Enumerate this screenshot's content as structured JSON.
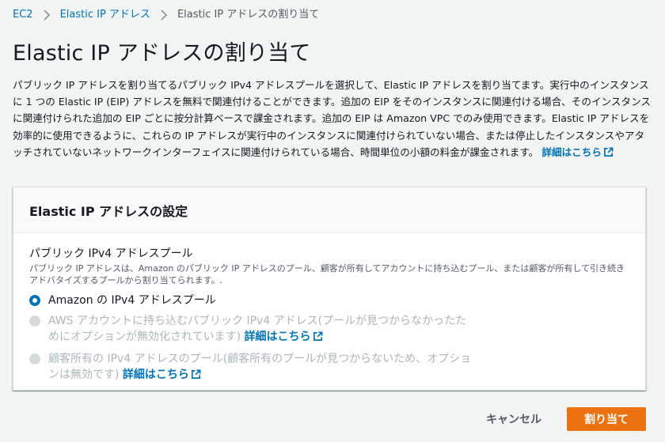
{
  "breadcrumb": {
    "items": [
      "EC2",
      "Elastic IP アドレス"
    ],
    "current": "Elastic IP アドレスの割り当て"
  },
  "page": {
    "title": "Elastic IP アドレスの割り当て",
    "description": "パブリック IP アドレスを割り当てるパブリック IPv4 アドレスプールを選択して、Elastic IP アドレスを割り当てます。実行中のインスタンスに 1 つの Elastic IP (EIP) アドレスを無料で関連付けることができます。追加の EIP をそのインスタンスに関連付ける場合、そのインスタンスに関連付けられた追加の EIP ごとに按分計算ベースで課金されます。追加の EIP は Amazon VPC でのみ使用できます。Elastic IP アドレスを効率的に使用できるように、これらの IP アドレスが実行中のインスタンスに関連付けられていない場合、または停止したインスタンスやアタッチされていないネットワークインターフェイスに関連付けられている場合、時間単位の小額の料金が課金されます。",
    "learn_more": "詳細はこちら"
  },
  "panel": {
    "title": "Elastic IP アドレスの設定",
    "field_label": "パブリック IPv4 アドレスプール",
    "field_description": "パブリック IP アドレスは、Amazon のパブリック IP アドレスのプール、顧客が所有してアカウントに持ち込むプール、または顧客が所有して引き続きアドバタイズするプールから割り当てられます。.",
    "options": [
      {
        "label": "Amazon の IPv4 アドレスプール",
        "checked": true,
        "disabled": false
      },
      {
        "label": "AWS アカウントに持ち込むパブリック IPv4 アドレス(プールが見つからなかったためにオプションが無効化されています)",
        "link": "詳細はこちら",
        "checked": false,
        "disabled": true
      },
      {
        "label": "顧客所有の IPv4 アドレスのプール(顧客所有のプールが見つからないため、オプションは無効です)",
        "link": "詳細はこちら",
        "checked": false,
        "disabled": true
      }
    ]
  },
  "actions": {
    "cancel": "キャンセル",
    "submit": "割り当て"
  },
  "colors": {
    "link": "#0073bb",
    "primary": "#ec7211",
    "background": "#f2f3f3"
  }
}
